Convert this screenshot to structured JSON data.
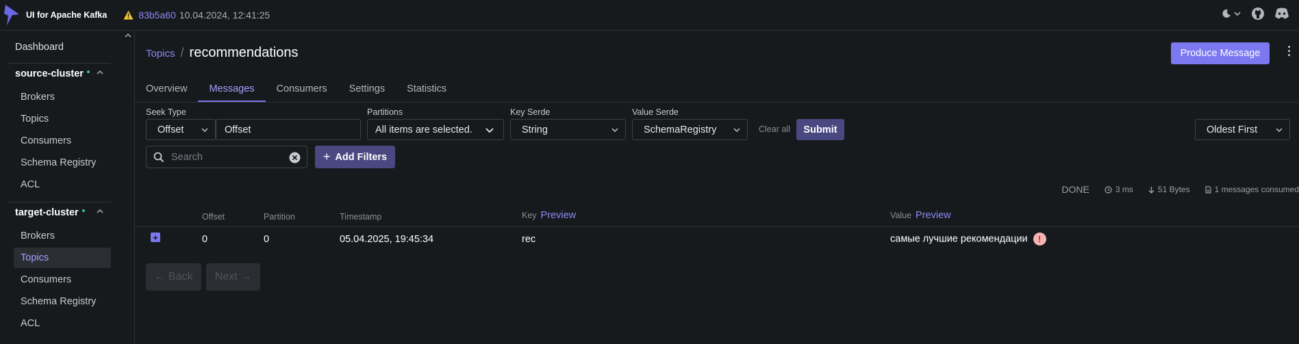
{
  "app": {
    "title": "UI for Apache Kafka",
    "commit": "83b5a60",
    "build_date": "10.04.2024, 12:41:25"
  },
  "sidebar": {
    "dashboard": "Dashboard",
    "clusters": [
      {
        "name": "source-cluster",
        "items": [
          "Brokers",
          "Topics",
          "Consumers",
          "Schema Registry",
          "ACL"
        ]
      },
      {
        "name": "target-cluster",
        "items": [
          "Brokers",
          "Topics",
          "Consumers",
          "Schema Registry",
          "ACL"
        ],
        "active_item": "Topics"
      }
    ]
  },
  "breadcrumb": {
    "parent": "Topics",
    "current": "recommendations"
  },
  "actions": {
    "produce_message": "Produce Message"
  },
  "tabs": [
    "Overview",
    "Messages",
    "Consumers",
    "Settings",
    "Statistics"
  ],
  "active_tab": "Messages",
  "filters": {
    "seek_type_label": "Seek Type",
    "seek_type_value": "Offset",
    "offset_placeholder": "Offset",
    "partitions_label": "Partitions",
    "partitions_value": "All items are selected.",
    "key_serde_label": "Key Serde",
    "key_serde_value": "String",
    "value_serde_label": "Value Serde",
    "value_serde_value": "SchemaRegistry",
    "clear_all": "Clear all",
    "submit": "Submit",
    "sort_value": "Oldest First",
    "search_placeholder": "Search",
    "add_filters": "Add Filters"
  },
  "stats": {
    "status": "DONE",
    "time": "3 ms",
    "bytes": "51 Bytes",
    "consumed": "1 messages consumed"
  },
  "table": {
    "headers": {
      "offset": "Offset",
      "partition": "Partition",
      "timestamp": "Timestamp",
      "key": "Key",
      "value": "Value",
      "preview": "Preview"
    },
    "rows": [
      {
        "offset": "0",
        "partition": "0",
        "timestamp": "05.04.2025, 19:45:34",
        "key": "rec",
        "value": "самые лучшие рекомендации"
      }
    ]
  },
  "pagination": {
    "back": "← Back",
    "next": "Next →"
  },
  "colors": {
    "accent": "#7b78f0",
    "background": "#171a1c",
    "online": "#2fce7c",
    "error": "#c0282d"
  }
}
